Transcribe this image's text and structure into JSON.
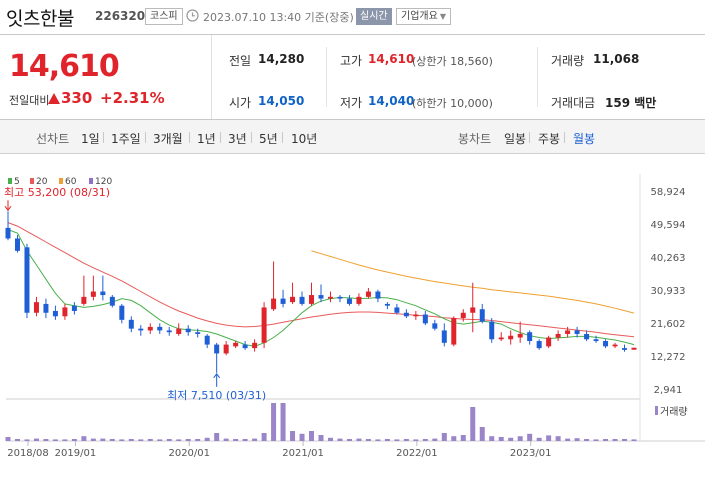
{
  "header": {
    "name": "잇츠한불",
    "code": "226320",
    "market": "코스피",
    "datetime": "2023.07.10 13:40 기준(장중)",
    "realtime": "실시간",
    "company_btn": "기업개요"
  },
  "quote": {
    "price": "14,610",
    "change_label": "전일대비",
    "change_amount": "330",
    "change_percent": "+2.31%",
    "prev_close_label": "전일",
    "prev_close": "14,280",
    "high_label": "고가",
    "high": "14,610",
    "upper_limit": "(상한가 18,560)",
    "volume_label": "거래량",
    "volume": "11,068",
    "open_label": "시가",
    "open": "14,050",
    "low_label": "저가",
    "low": "14,040",
    "lower_limit": "(하한가 10,000)",
    "amount_label": "거래대금",
    "amount": "159 백만"
  },
  "period_bar": {
    "line_label": "선차트",
    "line_items": [
      "1일",
      "1주일",
      "3개월",
      "1년",
      "3년",
      "5년",
      "10년"
    ],
    "candle_label": "봉차트",
    "candle_items": [
      "일봉",
      "주봉",
      "월봉"
    ],
    "active": "월봉"
  },
  "colors": {
    "up": "#e0242b",
    "down": "#1f5fd6",
    "ma5": "#48b04a",
    "ma20": "#e85a5a",
    "ma60": "#f0a030",
    "ma120": "#8e72c8",
    "volume": "#9b85c9"
  },
  "chart_data": {
    "type": "candlestick",
    "legend": [
      "5",
      "20",
      "60",
      "120"
    ],
    "y_ticks": [
      58924,
      49594,
      40263,
      30933,
      21602,
      12272,
      2941
    ],
    "y_tick_labels": [
      "58,924",
      "49,594",
      "40,263",
      "30,933",
      "21,602",
      "12,272",
      "2,941"
    ],
    "ylim": [
      2941,
      58924
    ],
    "x_ticks": [
      "2018/08",
      "2019/01",
      "2020/01",
      "2021/01",
      "2022/01",
      "2023/01"
    ],
    "high_annotation": "최고 53,200 (08/31)",
    "low_annotation": "최저 7,510 (03/31)",
    "volume_label": "거래량",
    "candles": [
      {
        "o": 48500,
        "c": 45500,
        "h": 53200,
        "l": 45000
      },
      {
        "o": 45500,
        "c": 42000,
        "h": 46500,
        "l": 41500
      },
      {
        "o": 43000,
        "c": 24500,
        "h": 44000,
        "l": 23000
      },
      {
        "o": 24500,
        "c": 27500,
        "h": 29000,
        "l": 23500
      },
      {
        "o": 27000,
        "c": 24500,
        "h": 28500,
        "l": 23000
      },
      {
        "o": 25000,
        "c": 23500,
        "h": 26500,
        "l": 22500
      },
      {
        "o": 23500,
        "c": 26000,
        "h": 27000,
        "l": 22500
      },
      {
        "o": 26500,
        "c": 25000,
        "h": 27500,
        "l": 24000
      },
      {
        "o": 27000,
        "c": 29000,
        "h": 35000,
        "l": 26500
      },
      {
        "o": 29000,
        "c": 30500,
        "h": 35000,
        "l": 28000
      },
      {
        "o": 30500,
        "c": 29500,
        "h": 35000,
        "l": 28000
      },
      {
        "o": 29000,
        "c": 26500,
        "h": 29500,
        "l": 26000
      },
      {
        "o": 26500,
        "c": 22500,
        "h": 27000,
        "l": 21500
      },
      {
        "o": 22500,
        "c": 20000,
        "h": 23500,
        "l": 19000
      },
      {
        "o": 20000,
        "c": 19500,
        "h": 21000,
        "l": 18000
      },
      {
        "o": 19500,
        "c": 20500,
        "h": 21500,
        "l": 18500
      },
      {
        "o": 20500,
        "c": 19500,
        "h": 21500,
        "l": 18500
      },
      {
        "o": 19500,
        "c": 19000,
        "h": 20500,
        "l": 18000
      },
      {
        "o": 18500,
        "c": 20000,
        "h": 21500,
        "l": 18000
      },
      {
        "o": 20000,
        "c": 19000,
        "h": 21000,
        "l": 18000
      },
      {
        "o": 19000,
        "c": 18500,
        "h": 20000,
        "l": 17500
      },
      {
        "o": 18000,
        "c": 15500,
        "h": 18500,
        "l": 14500
      },
      {
        "o": 15500,
        "c": 13000,
        "h": 16000,
        "l": 7510
      },
      {
        "o": 13000,
        "c": 15500,
        "h": 16500,
        "l": 12500
      },
      {
        "o": 15000,
        "c": 16000,
        "h": 16500,
        "l": 14500
      },
      {
        "o": 15500,
        "c": 14500,
        "h": 16500,
        "l": 14000
      },
      {
        "o": 14500,
        "c": 16000,
        "h": 17000,
        "l": 13500
      },
      {
        "o": 16000,
        "c": 26000,
        "h": 27500,
        "l": 14500
      },
      {
        "o": 25500,
        "c": 28500,
        "h": 39000,
        "l": 25000
      },
      {
        "o": 28500,
        "c": 27000,
        "h": 31000,
        "l": 26000
      },
      {
        "o": 27500,
        "c": 29000,
        "h": 33000,
        "l": 27000
      },
      {
        "o": 29000,
        "c": 27000,
        "h": 30500,
        "l": 26500
      },
      {
        "o": 27000,
        "c": 29500,
        "h": 33000,
        "l": 26500
      },
      {
        "o": 29500,
        "c": 28500,
        "h": 32500,
        "l": 27500
      },
      {
        "o": 28500,
        "c": 29000,
        "h": 30500,
        "l": 27500
      },
      {
        "o": 29000,
        "c": 28500,
        "h": 29500,
        "l": 27500
      },
      {
        "o": 28500,
        "c": 27000,
        "h": 29500,
        "l": 26500
      },
      {
        "o": 27000,
        "c": 29000,
        "h": 30000,
        "l": 26500
      },
      {
        "o": 29000,
        "c": 30500,
        "h": 31500,
        "l": 28500
      },
      {
        "o": 30500,
        "c": 28500,
        "h": 31000,
        "l": 27500
      },
      {
        "o": 27000,
        "c": 26500,
        "h": 27500,
        "l": 25500
      },
      {
        "o": 26000,
        "c": 24500,
        "h": 27000,
        "l": 24000
      },
      {
        "o": 24500,
        "c": 23500,
        "h": 25500,
        "l": 23000
      },
      {
        "o": 23500,
        "c": 24000,
        "h": 25000,
        "l": 22500
      },
      {
        "o": 24000,
        "c": 21500,
        "h": 25000,
        "l": 21000
      },
      {
        "o": 21500,
        "c": 20000,
        "h": 22500,
        "l": 19500
      },
      {
        "o": 19500,
        "c": 16000,
        "h": 21500,
        "l": 15000
      },
      {
        "o": 15500,
        "c": 23000,
        "h": 23500,
        "l": 15000
      },
      {
        "o": 23000,
        "c": 24500,
        "h": 25500,
        "l": 22000
      },
      {
        "o": 24500,
        "c": 26000,
        "h": 33000,
        "l": 19000
      },
      {
        "o": 25500,
        "c": 22000,
        "h": 27000,
        "l": 21500
      },
      {
        "o": 22000,
        "c": 17000,
        "h": 23000,
        "l": 16000
      },
      {
        "o": 17000,
        "c": 17500,
        "h": 19000,
        "l": 16500
      },
      {
        "o": 17000,
        "c": 18000,
        "h": 19500,
        "l": 15500
      },
      {
        "o": 17500,
        "c": 18500,
        "h": 22000,
        "l": 16000
      },
      {
        "o": 19000,
        "c": 16500,
        "h": 19500,
        "l": 15500
      },
      {
        "o": 16500,
        "c": 14500,
        "h": 17000,
        "l": 14000
      },
      {
        "o": 15000,
        "c": 17500,
        "h": 18000,
        "l": 14500
      },
      {
        "o": 17500,
        "c": 18500,
        "h": 19500,
        "l": 16500
      },
      {
        "o": 18500,
        "c": 19500,
        "h": 20500,
        "l": 17500
      },
      {
        "o": 19500,
        "c": 18500,
        "h": 20500,
        "l": 17500
      },
      {
        "o": 18500,
        "c": 17000,
        "h": 19500,
        "l": 16500
      },
      {
        "o": 17000,
        "c": 16500,
        "h": 18000,
        "l": 16000
      },
      {
        "o": 16500,
        "c": 15000,
        "h": 17000,
        "l": 14500
      },
      {
        "o": 15000,
        "c": 15500,
        "h": 16000,
        "l": 14500
      },
      {
        "o": 14500,
        "c": 14000,
        "h": 15500,
        "l": 13500
      },
      {
        "o": 14050,
        "c": 14610,
        "h": 14610,
        "l": 14040
      }
    ],
    "ma5": [
      48000,
      47000,
      42000,
      38000,
      34000,
      30000,
      27000,
      26500,
      26000,
      26300,
      26800,
      27500,
      28500,
      28000,
      26500,
      24500,
      22500,
      21000,
      20000,
      19700,
      19500,
      19200,
      18500,
      17500,
      16500,
      15500,
      15000,
      16000,
      17500,
      19500,
      22000,
      24500,
      26500,
      27800,
      28500,
      28800,
      28700,
      28500,
      28600,
      28800,
      28700,
      28200,
      27300,
      26500,
      25300,
      24200,
      22800,
      21700,
      21300,
      21700,
      22100,
      21800,
      21300,
      20000,
      18900,
      18000,
      17500,
      17200,
      17400,
      17600,
      17800,
      17800,
      17600,
      17200,
      16800,
      16200,
      15500
    ],
    "ma20": [
      50000,
      49000,
      47500,
      46000,
      44500,
      43000,
      41500,
      40000,
      38500,
      37200,
      36000,
      34800,
      33500,
      32000,
      30500,
      29000,
      27500,
      26200,
      25000,
      24000,
      23000,
      22200,
      21500,
      21000,
      20700,
      20500,
      20600,
      20900,
      21300,
      21800,
      22300,
      22800,
      23300,
      23700,
      24100,
      24400,
      24600,
      24700,
      24700,
      24600,
      24400,
      24200,
      24000,
      23800,
      23600,
      23400,
      23100,
      22900,
      22700,
      22600,
      22500,
      22300,
      22000,
      21700,
      21400,
      21100,
      20800,
      20500,
      20200,
      19900,
      19600,
      19300,
      19000,
      18600,
      18300,
      18000,
      17700
    ],
    "ma60_start": 32,
    "ma60": [
      42000,
      41200,
      40400,
      39600,
      38800,
      38000,
      37300,
      36600,
      36000,
      35400,
      34800,
      34300,
      33800,
      33300,
      32900,
      32500,
      32100,
      31700,
      31400,
      31000,
      30700,
      30400,
      30100,
      29800,
      29500,
      29200,
      28800,
      28400,
      28000,
      27500,
      27000,
      26400,
      25800,
      25100,
      24400
    ],
    "volume": [
      0.1,
      0.05,
      0.04,
      0.06,
      0.05,
      0.04,
      0.04,
      0.05,
      0.12,
      0.06,
      0.06,
      0.05,
      0.04,
      0.05,
      0.04,
      0.05,
      0.04,
      0.05,
      0.04,
      0.05,
      0.05,
      0.08,
      0.2,
      0.06,
      0.05,
      0.05,
      0.06,
      0.2,
      0.95,
      0.95,
      0.25,
      0.18,
      0.25,
      0.15,
      0.08,
      0.06,
      0.05,
      0.06,
      0.05,
      0.04,
      0.05,
      0.04,
      0.05,
      0.04,
      0.05,
      0.06,
      0.2,
      0.12,
      0.15,
      0.85,
      0.35,
      0.12,
      0.1,
      0.08,
      0.12,
      0.18,
      0.08,
      0.14,
      0.12,
      0.06,
      0.07,
      0.05,
      0.04,
      0.05,
      0.05,
      0.05,
      0.04
    ]
  }
}
